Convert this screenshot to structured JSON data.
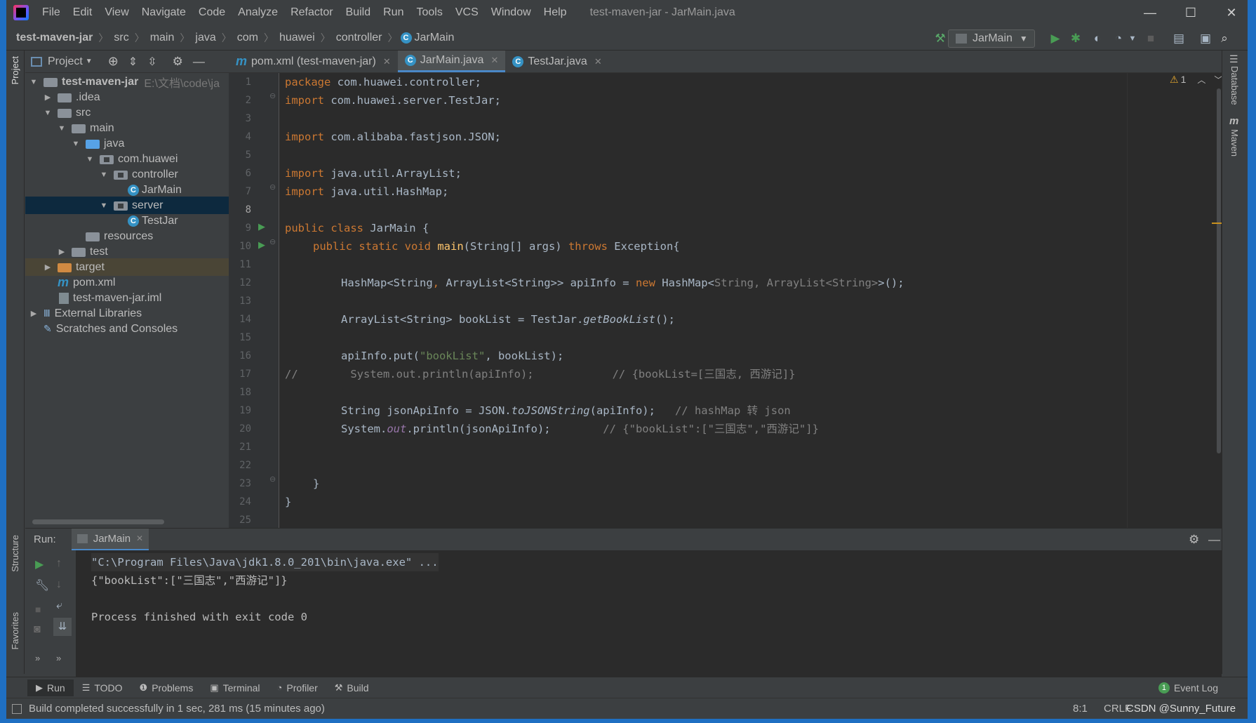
{
  "window": {
    "title": "test-maven-jar - JarMain.java",
    "controls": {
      "minimize": "—",
      "maximize": "☐",
      "close": "✕"
    }
  },
  "menu": [
    "File",
    "Edit",
    "View",
    "Navigate",
    "Code",
    "Analyze",
    "Refactor",
    "Build",
    "Run",
    "Tools",
    "VCS",
    "Window",
    "Help"
  ],
  "breadcrumbs": [
    "test-maven-jar",
    "src",
    "main",
    "java",
    "com",
    "huawei",
    "controller",
    "JarMain"
  ],
  "run_config": {
    "label": "JarMain"
  },
  "project_panel": {
    "title": "Project",
    "tree": [
      {
        "label": "test-maven-jar",
        "path": "E:\\文档\\code\\ja",
        "type": "module"
      },
      {
        "label": ".idea",
        "type": "folder"
      },
      {
        "label": "src",
        "type": "folder"
      },
      {
        "label": "main",
        "type": "folder"
      },
      {
        "label": "java",
        "type": "source-folder"
      },
      {
        "label": "com.huawei",
        "type": "package"
      },
      {
        "label": "controller",
        "type": "package"
      },
      {
        "label": "JarMain",
        "type": "class"
      },
      {
        "label": "server",
        "type": "package"
      },
      {
        "label": "TestJar",
        "type": "class"
      },
      {
        "label": "resources",
        "type": "resources-folder"
      },
      {
        "label": "test",
        "type": "folder"
      },
      {
        "label": "target",
        "type": "excluded-folder"
      },
      {
        "label": "pom.xml",
        "type": "maven-file"
      },
      {
        "label": "test-maven-jar.iml",
        "type": "iml-file"
      },
      {
        "label": "External Libraries",
        "type": "libraries"
      },
      {
        "label": "Scratches and Consoles",
        "type": "scratches"
      }
    ]
  },
  "tabs": [
    {
      "label": "pom.xml (test-maven-jar)",
      "icon": "maven-icon",
      "active": false
    },
    {
      "label": "JarMain.java",
      "icon": "class-icon",
      "active": true
    },
    {
      "label": "TestJar.java",
      "icon": "class-icon",
      "active": false
    }
  ],
  "editor": {
    "warnings": "1",
    "current_line": 8,
    "line_numbers": [
      "1",
      "2",
      "3",
      "4",
      "5",
      "6",
      "7",
      "8",
      "9",
      "10",
      "11",
      "12",
      "13",
      "14",
      "15",
      "16",
      "17",
      "18",
      "19",
      "20",
      "21",
      "22",
      "23",
      "24",
      "25"
    ],
    "code": {
      "l1_kw": "package",
      "l1_rest": " com.huawei.controller;",
      "l2_kw": "import",
      "l2_rest": " com.huawei.server.TestJar;",
      "l4_kw": "import",
      "l4_rest": " com.alibaba.fastjson.JSON;",
      "l6_kw": "import",
      "l6_rest": " java.util.ArrayList;",
      "l7_kw": "import",
      "l7_rest": " java.util.HashMap;",
      "l9_kw": "public class",
      "l9_rest": " JarMain {",
      "l10_kw1": "public static void",
      "l10_fn": "main",
      "l10_mid": "(String[] args) ",
      "l10_kw2": "throws",
      "l10_rest": " Exception{",
      "l12_a": "HashMap<String",
      "l12_b": ",",
      "l12_c": " ArrayList<String>> apiInfo = ",
      "l12_kw": "new",
      "l12_d": " HashMap<",
      "l12_e": "String, ArrayList<String>",
      "l12_f": ">();",
      "l14_a": "ArrayList<String> bookList = TestJar.",
      "l14_m": "getBookList",
      "l14_b": "();",
      "l16_a": "apiInfo.put(",
      "l16_s": "\"bookList\"",
      "l16_b": ", bookList);",
      "l17": "//        System.out.println(apiInfo);            // {bookList=[三国志, 西游记]}",
      "l19_a": "String jsonApiInfo = JSON.",
      "l19_m": "toJSONString",
      "l19_b": "(apiInfo);   ",
      "l19_c": "// hashMap 转 json",
      "l20_a": "System.",
      "l20_f": "out",
      "l20_b": ".println(jsonApiInfo);        ",
      "l20_c": "// {\"bookList\":[\"三国志\",\"西游记\"]}",
      "l22": "}",
      "l23": "}"
    }
  },
  "run_panel": {
    "label": "Run:",
    "tab": "JarMain",
    "output": [
      "\"C:\\Program Files\\Java\\jdk1.8.0_201\\bin\\java.exe\" ...",
      "{\"bookList\":[\"三国志\",\"西游记\"]}",
      "",
      "Process finished with exit code 0"
    ]
  },
  "tool_windows_left": [
    "Project",
    "Structure",
    "Favorites"
  ],
  "tool_windows_right": [
    "Database",
    "Maven"
  ],
  "bottom_tools": [
    "Run",
    "TODO",
    "Problems",
    "Terminal",
    "Profiler",
    "Build"
  ],
  "event_log": {
    "label": "Event Log",
    "count": "1"
  },
  "status": {
    "message": "Build completed successfully in 1 sec, 281 ms (15 minutes ago)",
    "position": "8:1",
    "line_sep": "CRLF",
    "watermark": "CSDN @Sunny_Future"
  },
  "colors": {
    "accent": "#4a88c7",
    "keyword": "#cc7832",
    "string": "#6a8759",
    "comment": "#808080",
    "run_green": "#499c54"
  }
}
